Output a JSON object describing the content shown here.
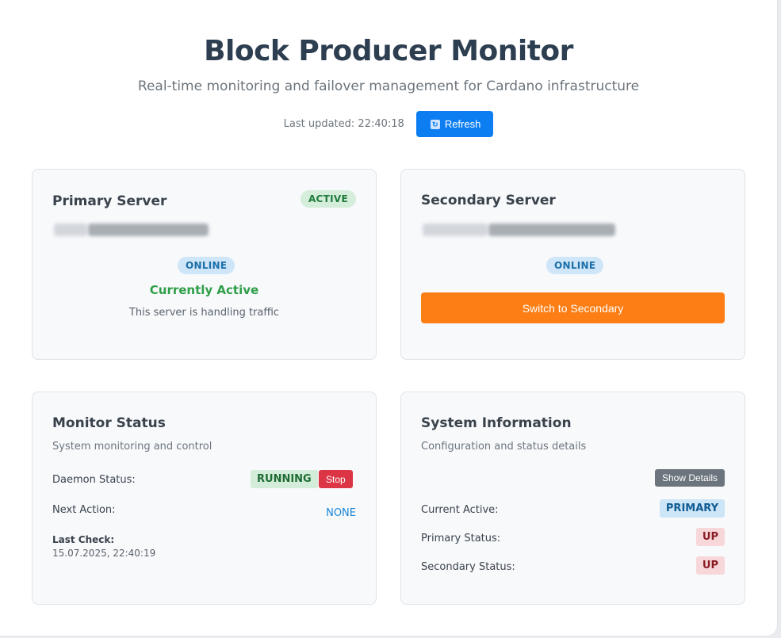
{
  "header": {
    "title": "Block Producer Monitor",
    "subtitle": "Real-time monitoring and failover management for Cardano infrastructure",
    "last_updated": "Last updated: 22:40:18",
    "refresh_label": "Refresh",
    "refresh_icon": "refresh-icon"
  },
  "primary": {
    "title": "Primary Server",
    "role_badge": "ACTIVE",
    "status": "ONLINE",
    "active_text": "Currently Active",
    "traffic_text": "This server is handling traffic"
  },
  "secondary": {
    "title": "Secondary Server",
    "status": "ONLINE",
    "switch_label": "Switch to Secondary"
  },
  "monitor": {
    "title": "Monitor Status",
    "subtitle": "System monitoring and control",
    "daemon_label": "Daemon Status:",
    "daemon_value": "RUNNING",
    "stop_label": "Stop",
    "next_action_label": "Next Action:",
    "next_action_value": "NONE",
    "last_check_label": "Last Check:",
    "last_check_value": "15.07.2025, 22:40:19"
  },
  "sysinfo": {
    "title": "System Information",
    "subtitle": "Configuration and status details",
    "details_label": "Show Details",
    "current_active_label": "Current Active:",
    "current_active_value": "PRIMARY",
    "primary_status_label": "Primary Status:",
    "primary_status_value": "UP",
    "secondary_status_label": "Secondary Status:",
    "secondary_status_value": "UP"
  },
  "colors": {
    "refresh_button": "#0d7ef2",
    "switch_button": "#fd7e14",
    "stop_button": "#dc3545",
    "details_button": "#6c757d",
    "active_text": "#2f9e48"
  }
}
